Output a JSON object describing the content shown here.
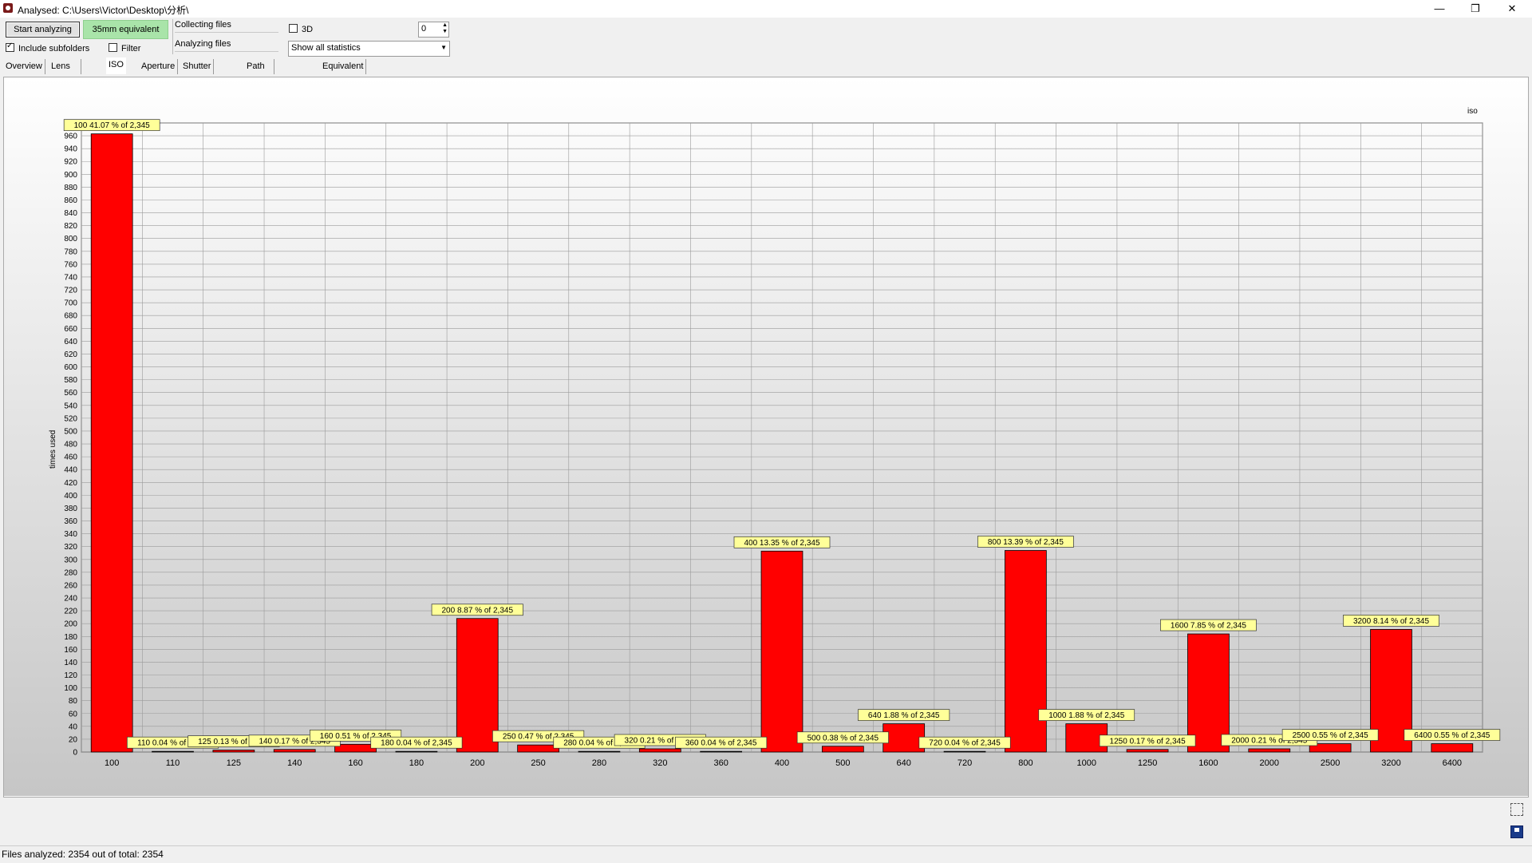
{
  "window": {
    "title": "Analysed: C:\\Users\\Victor\\Desktop\\分析\\",
    "minimize": "—",
    "restore": "❐",
    "close": "✕"
  },
  "toolbar": {
    "start_label": "Start analyzing",
    "equiv_label": "35mm equivalent",
    "include_subfolders_label": "Include subfolders",
    "include_subfolders_checked": true,
    "filter_label": "Filter",
    "filter_checked": false,
    "collecting_label": "Collecting files",
    "analyzing_label": "Analyzing files",
    "three_d_label": "3D",
    "three_d_checked": false,
    "spin_value": "0",
    "stats_select_value": "Show all statistics"
  },
  "tabs": [
    "Overview",
    "Lens Length",
    "ISO",
    "Aperture",
    "Shutter Speed",
    "Path List + Image",
    "Equivalent List"
  ],
  "active_tab": "ISO",
  "colors": {
    "bar": "#ff0000",
    "label_bg": "#ffff99",
    "legend": "#00008b"
  },
  "chart_data": {
    "type": "bar",
    "legend": "iso",
    "ylabel": "times used",
    "ylim": [
      0,
      980
    ],
    "ytick_step": 20,
    "categories": [
      "100",
      "110",
      "125",
      "140",
      "160",
      "180",
      "200",
      "250",
      "280",
      "320",
      "360",
      "400",
      "500",
      "640",
      "720",
      "800",
      "1000",
      "1250",
      "1600",
      "2000",
      "2500",
      "3200",
      "6400"
    ],
    "values": [
      963,
      1,
      3,
      4,
      12,
      1,
      208,
      11,
      1,
      5,
      1,
      313,
      9,
      44,
      1,
      314,
      44,
      4,
      184,
      5,
      13,
      191,
      13
    ],
    "labels": [
      "100 41.07 % of 2,345",
      "110 0.04 % of 2,345",
      "125 0.13 % of 2,345",
      "140 0.17 % of 2,345",
      "160 0.51 % of 2,345",
      "180 0.04 % of 2,345",
      "200 8.87 % of 2,345",
      "250 0.47 % of 2,345",
      "280 0.04 % of 2,345",
      "320 0.21 % of 2,345",
      "360 0.04 % of 2,345",
      "400 13.35 % of 2,345",
      "500 0.38 % of 2,345",
      "640 1.88 % of 2,345",
      "720 0.04 % of 2,345",
      "800 13.39 % of 2,345",
      "1000 1.88 % of 2,345",
      "1250 0.17 % of 2,345",
      "1600 7.85 % of 2,345",
      "2000 0.21 % of 2,345",
      "2500 0.55 % of 2,345",
      "3200 8.14 % of 2,345",
      "6400 0.55 % of 2,345"
    ],
    "grid": true
  },
  "status": {
    "text": "Files analyzed: 2354 out of total: 2354"
  }
}
